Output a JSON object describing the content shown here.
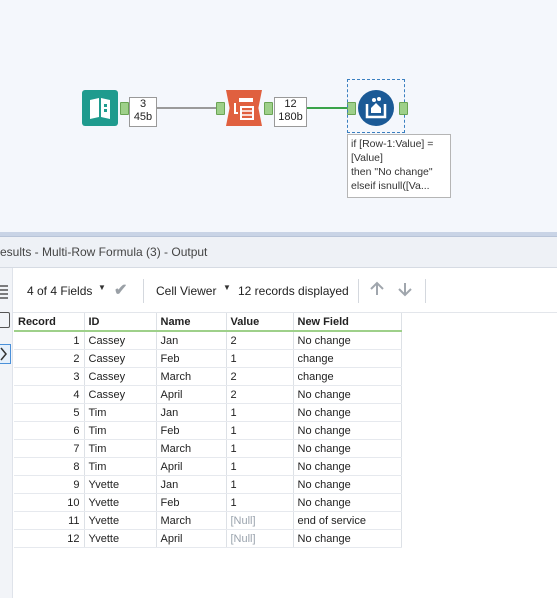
{
  "workflow": {
    "connection1": {
      "records": "3",
      "size": "45b"
    },
    "connection2": {
      "records": "12",
      "size": "180b"
    },
    "annotation": "if [Row-1:Value] =\n[Value]\nthen \"No change\"\nelseif isnull([Va..."
  },
  "results": {
    "title": "esults - Multi-Row Formula (3) - Output"
  },
  "toolbar": {
    "fields_label": "4 of 4 Fields",
    "viewer_label": "Cell Viewer",
    "records_label": "12 records displayed"
  },
  "grid": {
    "columns": [
      "Record",
      "ID",
      "Name",
      "Value",
      "New Field"
    ],
    "rows": [
      [
        "1",
        "Cassey",
        "Jan",
        "2",
        "No change"
      ],
      [
        "2",
        "Cassey",
        "Feb",
        "1",
        "change"
      ],
      [
        "3",
        "Cassey",
        "March",
        "2",
        "change"
      ],
      [
        "4",
        "Cassey",
        "April",
        "2",
        "No change"
      ],
      [
        "5",
        "Tim",
        "Jan",
        "1",
        "No change"
      ],
      [
        "6",
        "Tim",
        "Feb",
        "1",
        "No change"
      ],
      [
        "7",
        "Tim",
        "March",
        "1",
        "No change"
      ],
      [
        "8",
        "Tim",
        "April",
        "1",
        "No change"
      ],
      [
        "9",
        "Yvette",
        "Jan",
        "1",
        "No change"
      ],
      [
        "10",
        "Yvette",
        "Feb",
        "1",
        "No change"
      ],
      [
        "11",
        "Yvette",
        "March",
        "[Null]",
        "end of service"
      ],
      [
        "12",
        "Yvette",
        "April",
        "[Null]",
        "No change"
      ]
    ]
  },
  "colors": {
    "input_tool": "#1f9b8e",
    "transpose_tool": "#e0603f",
    "multirow_tool": "#1b5a96",
    "connection_gray": "#9a9a9a",
    "connection_green": "#3aa34a",
    "anchor": "#9ed08a",
    "null_text": "#9aa3ad"
  },
  "icons": {
    "input_tool": "book-icon",
    "transpose_tool": "transpose-icon",
    "multirow_tool": "multi-row-formula-icon",
    "fields_check": "checkmark-icon",
    "nav_up": "arrow-up-icon",
    "nav_down": "arrow-down-icon"
  }
}
